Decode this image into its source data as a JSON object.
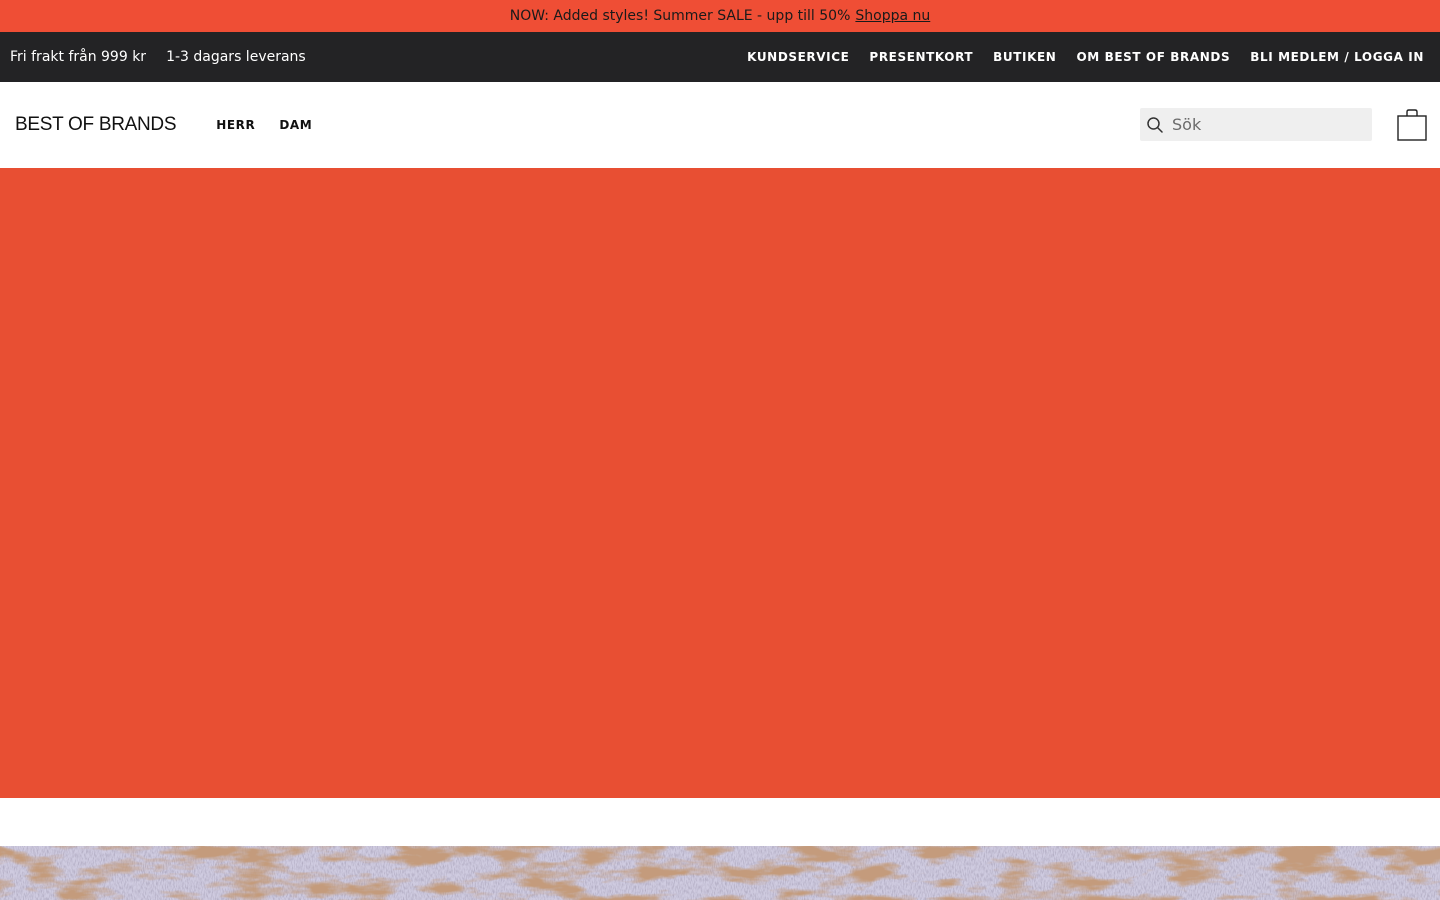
{
  "promo": {
    "text": "NOW: Added styles! Summer SALE - upp till 50%",
    "link": "Shoppa nu"
  },
  "utility": {
    "left": [
      "Fri frakt från 999 kr",
      "1-3 dagars leverans"
    ],
    "nav": [
      "KUNDSERVICE",
      "PRESENTKORT",
      "BUTIKEN",
      "OM BEST OF BRANDS",
      "BLI MEDLEM / LOGGA IN"
    ]
  },
  "header": {
    "logo": "BEST OF BRANDS",
    "nav": [
      "HERR",
      "DAM"
    ],
    "search": {
      "placeholder": "Sök",
      "value": "",
      "icon": "search-icon"
    },
    "cart_icon": "shopping-bag-icon"
  },
  "colors": {
    "promo_bg": "#ef4e35",
    "utility_bg": "#232325",
    "hero_bg": "#e84f33",
    "search_bg": "#efefef"
  }
}
